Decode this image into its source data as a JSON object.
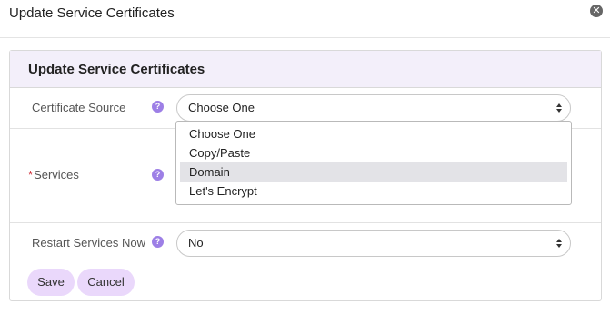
{
  "modal": {
    "title": "Update Service Certificates",
    "close_icon": "close-circle-icon"
  },
  "panel": {
    "heading": "Update Service Certificates"
  },
  "form": {
    "certificate_source": {
      "label": "Certificate Source",
      "help": "?",
      "value": "Choose One",
      "options": [
        "Choose One",
        "Copy/Paste",
        "Domain",
        "Let's Encrypt"
      ],
      "highlighted_option": "Domain",
      "dropdown_open": true
    },
    "services": {
      "required_mark": "*",
      "label": "Services",
      "help": "?"
    },
    "restart_services": {
      "label": "Restart Services Now",
      "help": "?",
      "value": "No"
    }
  },
  "actions": {
    "save_label": "Save",
    "cancel_label": "Cancel"
  },
  "colors": {
    "heading_bg": "#f3effa",
    "help_icon": "#9d7fe6",
    "button_bg": "#ead8fb",
    "required": "#d0303a",
    "highlight": "#e3e3e7"
  }
}
